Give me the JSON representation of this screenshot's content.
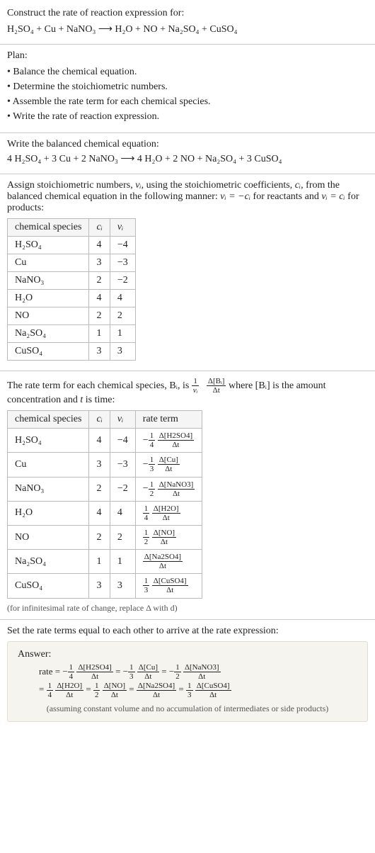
{
  "prompt": {
    "title": "Construct the rate of reaction expression for:",
    "equation": "H₂SO₄ + Cu + NaNO₃  ⟶  H₂O + NO + Na₂SO₄ + CuSO₄"
  },
  "plan": {
    "heading": "Plan:",
    "items": [
      "Balance the chemical equation.",
      "Determine the stoichiometric numbers.",
      "Assemble the rate term for each chemical species.",
      "Write the rate of reaction expression."
    ]
  },
  "balanced": {
    "heading": "Write the balanced chemical equation:",
    "equation": "4 H₂SO₄ + 3 Cu + 2 NaNO₃  ⟶  4 H₂O + 2 NO + Na₂SO₄ + 3 CuSO₄"
  },
  "assign": {
    "text_a": "Assign stoichiometric numbers, ",
    "nu": "νᵢ",
    "text_b": ", using the stoichiometric coefficients, ",
    "ci": "cᵢ",
    "text_c": ", from the balanced chemical equation in the following manner: ",
    "rel1": "νᵢ = −cᵢ",
    "text_d": " for reactants and ",
    "rel2": "νᵢ = cᵢ",
    "text_e": " for products:",
    "headers": [
      "chemical species",
      "cᵢ",
      "νᵢ"
    ],
    "rows": [
      [
        "H₂SO₄",
        "4",
        "−4"
      ],
      [
        "Cu",
        "3",
        "−3"
      ],
      [
        "NaNO₃",
        "2",
        "−2"
      ],
      [
        "H₂O",
        "4",
        "4"
      ],
      [
        "NO",
        "2",
        "2"
      ],
      [
        "Na₂SO₄",
        "1",
        "1"
      ],
      [
        "CuSO₄",
        "3",
        "3"
      ]
    ]
  },
  "rateterm": {
    "text_a": "The rate term for each chemical species, Bᵢ, is ",
    "frac1_num": "1",
    "frac1_den": "νᵢ",
    "frac2_num": "Δ[Bᵢ]",
    "frac2_den": "Δt",
    "text_b": " where [Bᵢ] is the amount concentration and ",
    "t": "t",
    "text_c": " is time:",
    "headers": [
      "chemical species",
      "cᵢ",
      "νᵢ",
      "rate term"
    ],
    "rows": [
      {
        "sp": "H₂SO₄",
        "c": "4",
        "nu": "−4",
        "sign": "−",
        "coef_num": "1",
        "coef_den": "4",
        "d_num": "Δ[H2SO4]",
        "d_den": "Δt"
      },
      {
        "sp": "Cu",
        "c": "3",
        "nu": "−3",
        "sign": "−",
        "coef_num": "1",
        "coef_den": "3",
        "d_num": "Δ[Cu]",
        "d_den": "Δt"
      },
      {
        "sp": "NaNO₃",
        "c": "2",
        "nu": "−2",
        "sign": "−",
        "coef_num": "1",
        "coef_den": "2",
        "d_num": "Δ[NaNO3]",
        "d_den": "Δt"
      },
      {
        "sp": "H₂O",
        "c": "4",
        "nu": "4",
        "sign": "",
        "coef_num": "1",
        "coef_den": "4",
        "d_num": "Δ[H2O]",
        "d_den": "Δt"
      },
      {
        "sp": "NO",
        "c": "2",
        "nu": "2",
        "sign": "",
        "coef_num": "1",
        "coef_den": "2",
        "d_num": "Δ[NO]",
        "d_den": "Δt"
      },
      {
        "sp": "Na₂SO₄",
        "c": "1",
        "nu": "1",
        "sign": "",
        "coef_num": "",
        "coef_den": "",
        "d_num": "Δ[Na2SO4]",
        "d_den": "Δt"
      },
      {
        "sp": "CuSO₄",
        "c": "3",
        "nu": "3",
        "sign": "",
        "coef_num": "1",
        "coef_den": "3",
        "d_num": "Δ[CuSO4]",
        "d_den": "Δt"
      }
    ],
    "note": "(for infinitesimal rate of change, replace Δ with d)"
  },
  "final": {
    "heading": "Set the rate terms equal to each other to arrive at the rate expression:",
    "answer_label": "Answer:",
    "line1_prefix": "rate = ",
    "terms_line1": [
      {
        "sign": "−",
        "cn": "1",
        "cd": "4",
        "dn": "Δ[H2SO4]",
        "dd": "Δt"
      },
      {
        "sign": "−",
        "cn": "1",
        "cd": "3",
        "dn": "Δ[Cu]",
        "dd": "Δt"
      },
      {
        "sign": "−",
        "cn": "1",
        "cd": "2",
        "dn": "Δ[NaNO3]",
        "dd": "Δt"
      }
    ],
    "line2_prefix": "= ",
    "terms_line2": [
      {
        "sign": "",
        "cn": "1",
        "cd": "4",
        "dn": "Δ[H2O]",
        "dd": "Δt"
      },
      {
        "sign": "",
        "cn": "1",
        "cd": "2",
        "dn": "Δ[NO]",
        "dd": "Δt"
      },
      {
        "sign": "",
        "cn": "",
        "cd": "",
        "dn": "Δ[Na2SO4]",
        "dd": "Δt"
      },
      {
        "sign": "",
        "cn": "1",
        "cd": "3",
        "dn": "Δ[CuSO4]",
        "dd": "Δt"
      }
    ],
    "assume": "(assuming constant volume and no accumulation of intermediates or side products)"
  },
  "chart_data": {
    "type": "table",
    "title": "Stoichiometric numbers and rate terms",
    "tables": [
      {
        "columns": [
          "chemical species",
          "c_i",
          "nu_i"
        ],
        "rows": [
          [
            "H2SO4",
            4,
            -4
          ],
          [
            "Cu",
            3,
            -3
          ],
          [
            "NaNO3",
            2,
            -2
          ],
          [
            "H2O",
            4,
            4
          ],
          [
            "NO",
            2,
            2
          ],
          [
            "Na2SO4",
            1,
            1
          ],
          [
            "CuSO4",
            3,
            3
          ]
        ]
      },
      {
        "columns": [
          "chemical species",
          "c_i",
          "nu_i",
          "rate term"
        ],
        "rows": [
          [
            "H2SO4",
            4,
            -4,
            "-(1/4) d[H2SO4]/dt"
          ],
          [
            "Cu",
            3,
            -3,
            "-(1/3) d[Cu]/dt"
          ],
          [
            "NaNO3",
            2,
            -2,
            "-(1/2) d[NaNO3]/dt"
          ],
          [
            "H2O",
            4,
            4,
            "(1/4) d[H2O]/dt"
          ],
          [
            "NO",
            2,
            2,
            "(1/2) d[NO]/dt"
          ],
          [
            "Na2SO4",
            1,
            1,
            "d[Na2SO4]/dt"
          ],
          [
            "CuSO4",
            3,
            3,
            "(1/3) d[CuSO4]/dt"
          ]
        ]
      }
    ],
    "rate_expression": "rate = -(1/4)Δ[H2SO4]/Δt = -(1/3)Δ[Cu]/Δt = -(1/2)Δ[NaNO3]/Δt = (1/4)Δ[H2O]/Δt = (1/2)Δ[NO]/Δt = Δ[Na2SO4]/Δt = (1/3)Δ[CuSO4]/Δt"
  }
}
